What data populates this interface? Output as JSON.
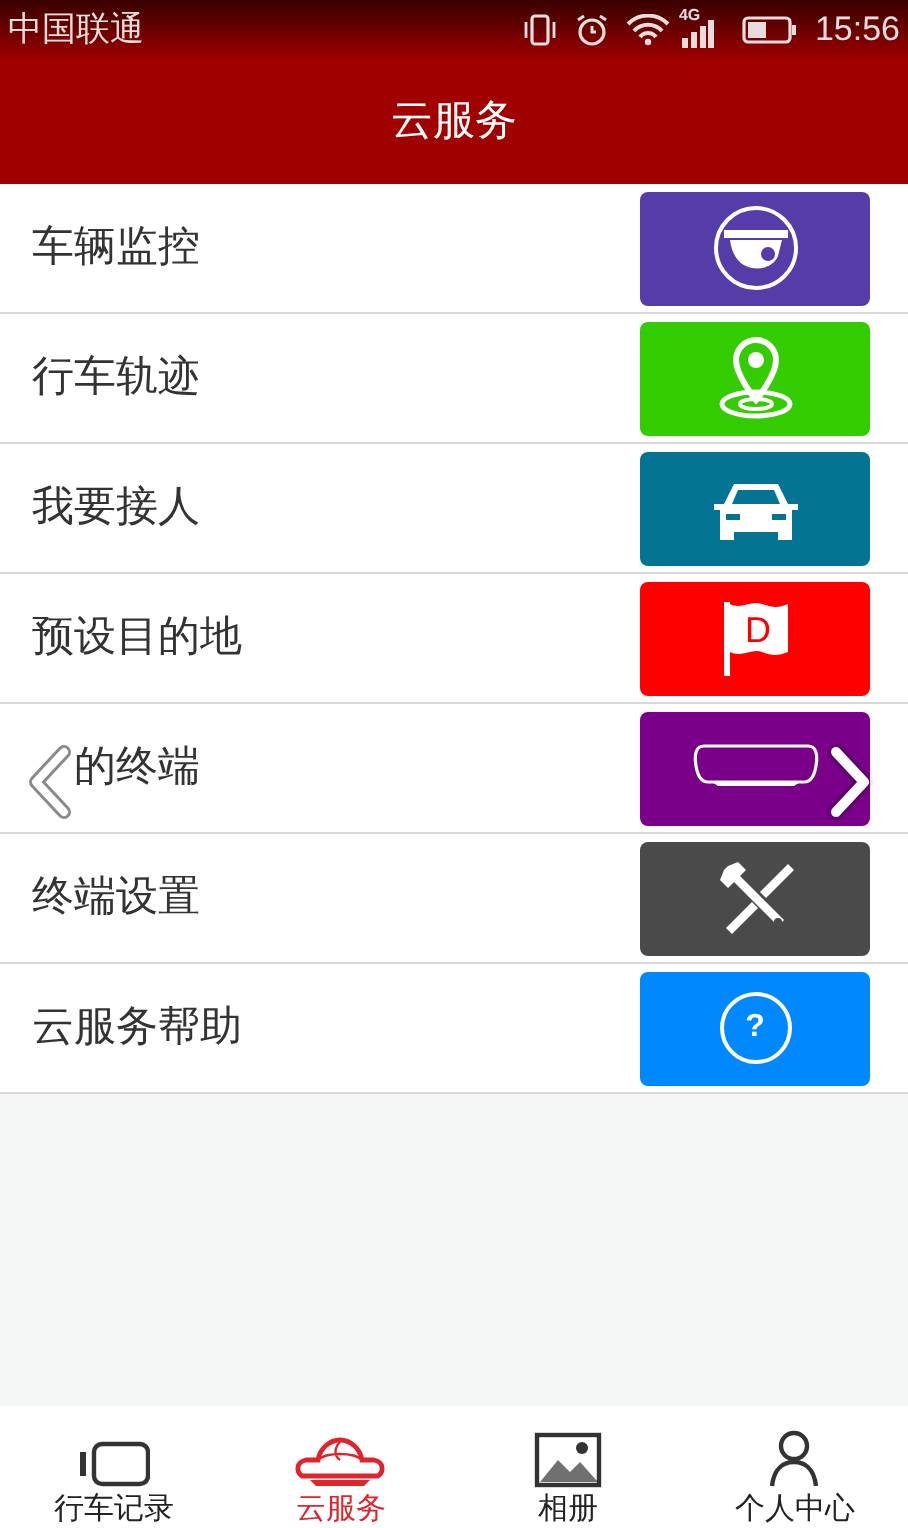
{
  "status_bar": {
    "carrier": "中国联通",
    "network": "4G",
    "time": "15:56"
  },
  "header": {
    "title": "云服务"
  },
  "services": [
    {
      "label": "车辆监控",
      "kind": "camera",
      "color": "#553ca8"
    },
    {
      "label": "行车轨迹",
      "kind": "pin",
      "color": "#33cc00"
    },
    {
      "label": "我要接人",
      "kind": "car",
      "color": "#037494"
    },
    {
      "label": "预设目的地",
      "kind": "flag",
      "color": "#ff0000",
      "icon_text": "D"
    },
    {
      "label": "的终端",
      "kind": "mirror",
      "color": "#7a008a",
      "obscured_start": true
    },
    {
      "label": "终端设置",
      "kind": "tools",
      "color": "#4a4a4a"
    },
    {
      "label": "云服务帮助",
      "kind": "help",
      "color": "#0088ff",
      "icon_text": "?"
    }
  ],
  "tabs": [
    {
      "label": "行车记录",
      "kind": "recorder",
      "selected": false
    },
    {
      "label": "云服务",
      "kind": "cloud",
      "selected": true
    },
    {
      "label": "相册",
      "kind": "album",
      "selected": false
    },
    {
      "label": "个人中心",
      "kind": "person",
      "selected": false
    }
  ]
}
